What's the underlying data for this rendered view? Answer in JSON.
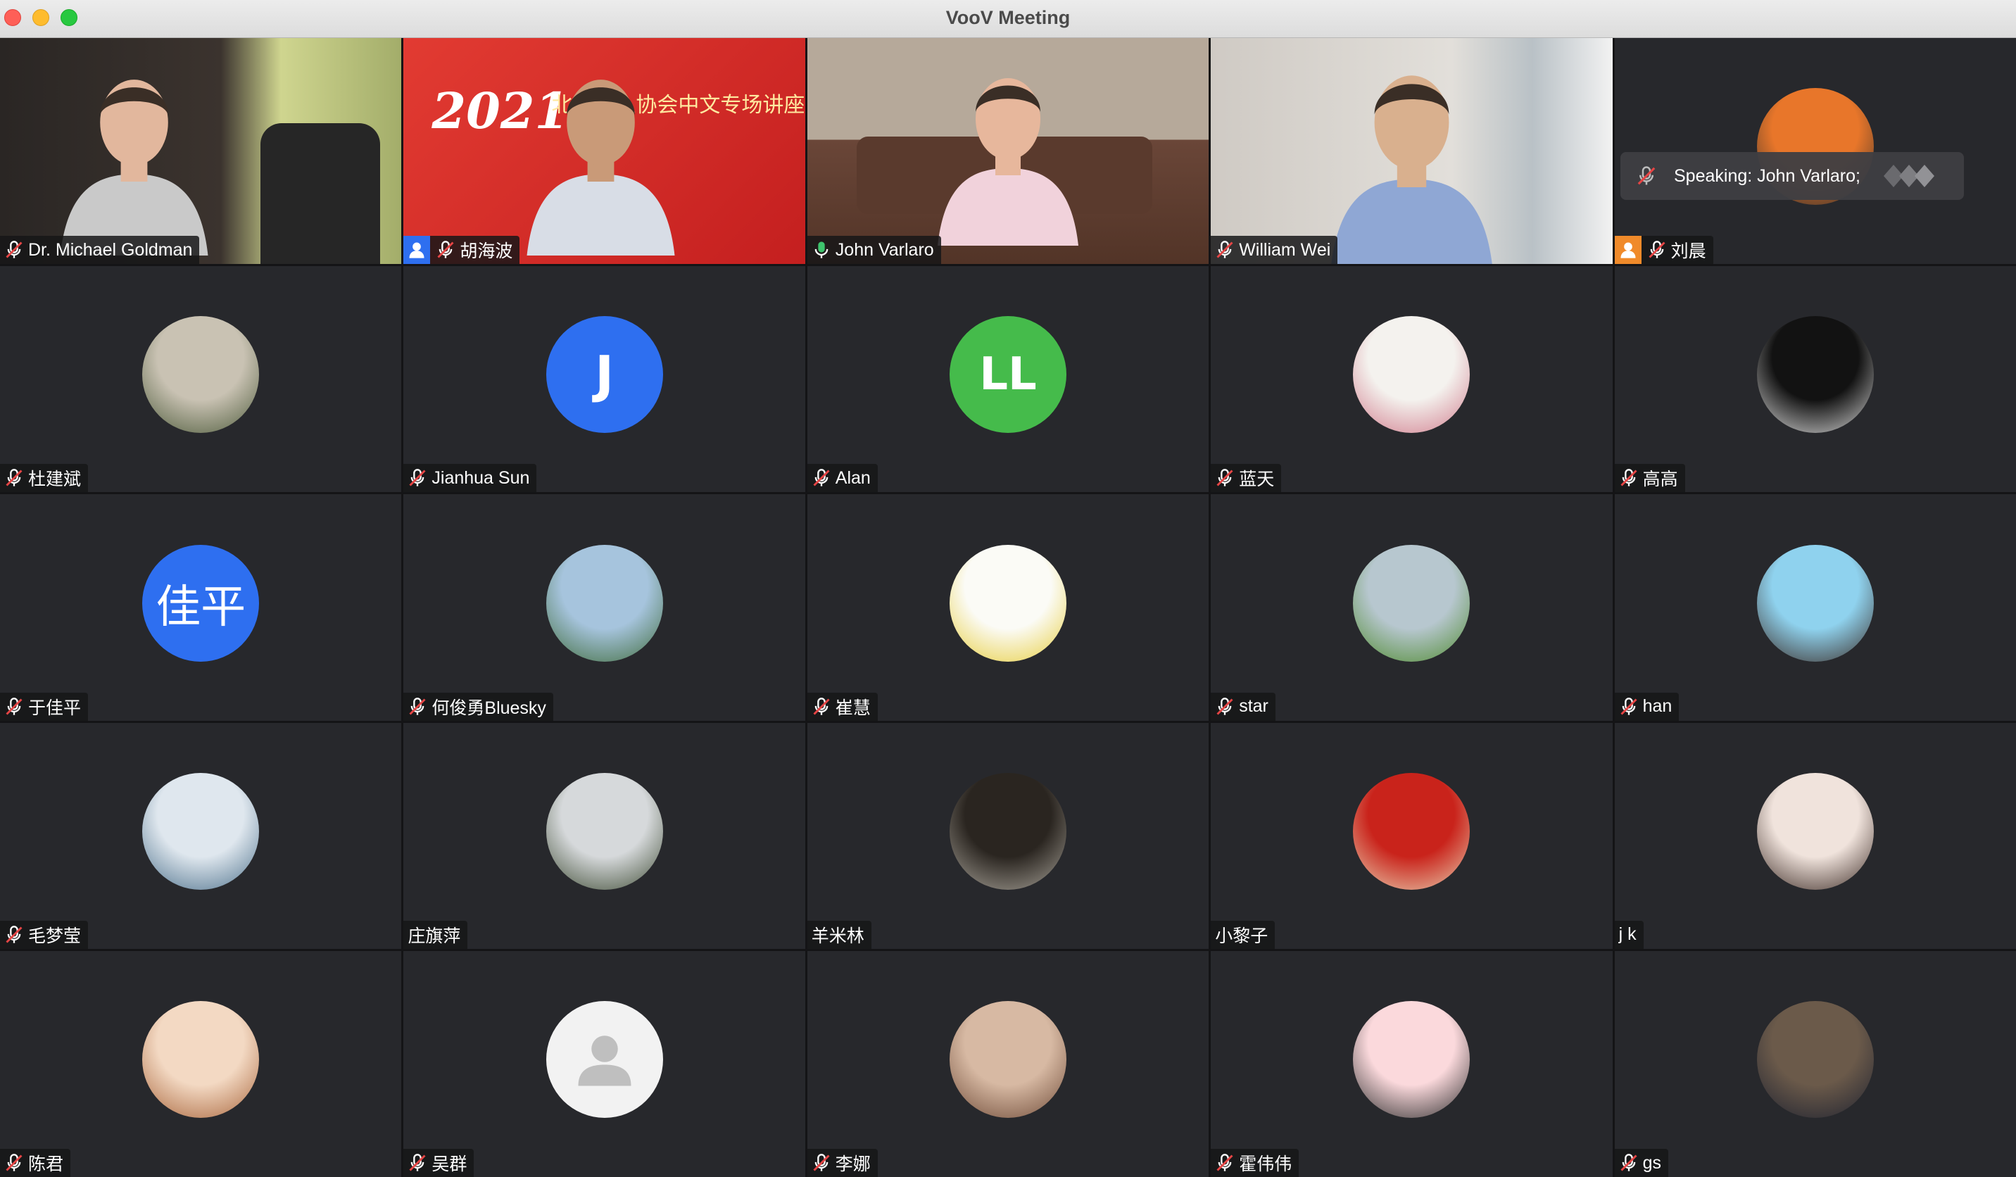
{
  "window": {
    "title": "VooV Meeting"
  },
  "speaking": {
    "label": "Speaking: John Varlaro;"
  },
  "participants": [
    {
      "name": "Dr. Michael Goldman",
      "kind": "video",
      "scene": "man-office",
      "mic": "muted"
    },
    {
      "name": "胡海波",
      "kind": "video",
      "scene": "man-banner",
      "mic": "muted",
      "badge": "blue-person",
      "banner_year": "2021",
      "banner_text": "北美华人协会中文专场讲座"
    },
    {
      "name": "John Varlaro",
      "kind": "video",
      "scene": "man-sofa",
      "mic": "active",
      "active": true
    },
    {
      "name": "William Wei",
      "kind": "video",
      "scene": "man-room",
      "mic": "muted"
    },
    {
      "name": "刘晨",
      "kind": "avatar",
      "avatar": {
        "style": "photo",
        "colors": [
          "#e8762a",
          "#2c2c2c"
        ]
      },
      "mic": "muted",
      "badge": "orange-person"
    },
    {
      "name": "杜建斌",
      "kind": "avatar",
      "avatar": {
        "style": "photo",
        "colors": [
          "#c9c2b3",
          "#4c5a3a"
        ]
      },
      "mic": "muted"
    },
    {
      "name": "Jianhua Sun",
      "kind": "avatar",
      "avatar": {
        "style": "letter",
        "text": "J",
        "bg": "#2e6ff0"
      },
      "mic": "muted"
    },
    {
      "name": "Alan",
      "kind": "avatar",
      "avatar": {
        "style": "letter",
        "text": "LL",
        "bg": "#45bb4b"
      },
      "mic": "muted"
    },
    {
      "name": "蓝天",
      "kind": "avatar",
      "avatar": {
        "style": "photo",
        "colors": [
          "#f4f2ee",
          "#d07a8b"
        ]
      },
      "mic": "muted"
    },
    {
      "name": "高高",
      "kind": "avatar",
      "avatar": {
        "style": "photo",
        "colors": [
          "#121212",
          "#dcdcdc"
        ]
      },
      "mic": "muted"
    },
    {
      "name": "于佳平",
      "kind": "avatar",
      "avatar": {
        "style": "letter",
        "text": "佳平",
        "bg": "#2e6ff0"
      },
      "mic": "muted"
    },
    {
      "name": "何俊勇Bluesky",
      "kind": "avatar",
      "avatar": {
        "style": "photo",
        "colors": [
          "#a6c4dd",
          "#3f6b3a"
        ]
      },
      "mic": "muted"
    },
    {
      "name": "崔慧",
      "kind": "avatar",
      "avatar": {
        "style": "photo",
        "colors": [
          "#fbfbf6",
          "#e7cd3b"
        ]
      },
      "mic": "muted"
    },
    {
      "name": "star",
      "kind": "avatar",
      "avatar": {
        "style": "photo",
        "colors": [
          "#b7c7cf",
          "#4e8a2e"
        ]
      },
      "mic": "muted"
    },
    {
      "name": "han",
      "kind": "avatar",
      "avatar": {
        "style": "photo",
        "colors": [
          "#8fd2ee",
          "#3a2b25"
        ]
      },
      "mic": "muted"
    },
    {
      "name": "毛梦莹",
      "kind": "avatar",
      "avatar": {
        "style": "photo",
        "colors": [
          "#dfe7ee",
          "#4b6f8a"
        ]
      },
      "mic": "muted"
    },
    {
      "name": "庄旗萍",
      "kind": "avatar",
      "avatar": {
        "style": "photo",
        "colors": [
          "#d6d9db",
          "#3d4a33"
        ]
      },
      "mic": "none"
    },
    {
      "name": "羊米林",
      "kind": "avatar",
      "avatar": {
        "style": "photo",
        "colors": [
          "#2a2520",
          "#a9a49a"
        ]
      },
      "mic": "none"
    },
    {
      "name": "小黎子",
      "kind": "avatar",
      "avatar": {
        "style": "photo",
        "colors": [
          "#c9231b",
          "#e9d2b2"
        ]
      },
      "mic": "none"
    },
    {
      "name": "j k",
      "kind": "avatar",
      "avatar": {
        "style": "photo",
        "colors": [
          "#f0e3dc",
          "#3b2a24"
        ]
      },
      "mic": "none"
    },
    {
      "name": "陈君",
      "kind": "avatar",
      "avatar": {
        "style": "photo",
        "colors": [
          "#f3d9c3",
          "#a8643a"
        ]
      },
      "mic": "muted"
    },
    {
      "name": "吴群",
      "kind": "avatar",
      "avatar": {
        "style": "default",
        "colors": [
          "#f2f2f2",
          "#bfbfbf"
        ]
      },
      "mic": "muted"
    },
    {
      "name": "李娜",
      "kind": "avatar",
      "avatar": {
        "style": "photo",
        "colors": [
          "#d7b9a3",
          "#6e4a37"
        ]
      },
      "mic": "muted"
    },
    {
      "name": "霍伟伟",
      "kind": "avatar",
      "avatar": {
        "style": "photo",
        "colors": [
          "#fbd9dc",
          "#2c2c2c"
        ]
      },
      "mic": "muted"
    },
    {
      "name": "gs",
      "kind": "avatar",
      "avatar": {
        "style": "photo",
        "colors": [
          "#6b5a4a",
          "#1e2230"
        ]
      },
      "mic": "muted"
    }
  ]
}
